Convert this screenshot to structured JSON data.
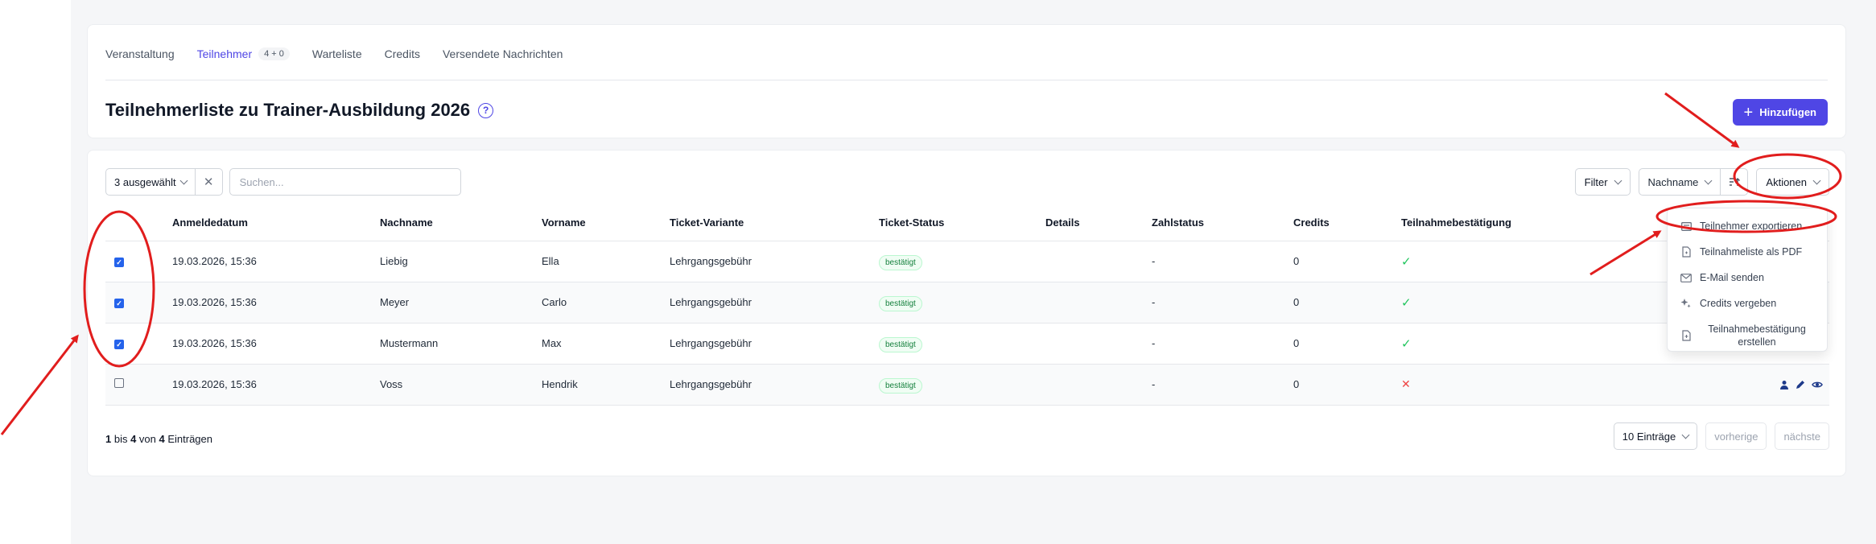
{
  "tabs": [
    {
      "label": "Veranstaltung",
      "active": false
    },
    {
      "label": "Teilnehmer",
      "active": true,
      "count": "4 + 0"
    },
    {
      "label": "Warteliste",
      "active": false
    },
    {
      "label": "Credits",
      "active": false
    },
    {
      "label": "Versendete Nachrichten",
      "active": false
    }
  ],
  "page_title": "Teilnehmerliste zu Trainer-Ausbildung 2026",
  "add_button": "Hinzufügen",
  "selection": {
    "label": "3 ausgewählt"
  },
  "search": {
    "placeholder": "Suchen...",
    "value": ""
  },
  "filter_label": "Filter",
  "sort_label": "Nachname",
  "actions_label": "Aktionen",
  "columns": [
    "Anmeldedatum",
    "Nachname",
    "Vorname",
    "Ticket-Variante",
    "Ticket-Status",
    "Details",
    "Zahlstatus",
    "Credits",
    "Teilnahmebestätigung"
  ],
  "rows": [
    {
      "checked": true,
      "date": "19.03.2026, 15:36",
      "last": "Liebig",
      "first": "Ella",
      "ticket": "Lehrgangsgebühr",
      "status": "bestätigt",
      "details": "",
      "pay": "-",
      "credits": "0",
      "confirm": "yes"
    },
    {
      "checked": true,
      "date": "19.03.2026, 15:36",
      "last": "Meyer",
      "first": "Carlo",
      "ticket": "Lehrgangsgebühr",
      "status": "bestätigt",
      "details": "",
      "pay": "-",
      "credits": "0",
      "confirm": "yes"
    },
    {
      "checked": true,
      "date": "19.03.2026, 15:36",
      "last": "Mustermann",
      "first": "Max",
      "ticket": "Lehrgangsgebühr",
      "status": "bestätigt",
      "details": "",
      "pay": "-",
      "credits": "0",
      "confirm": "yes"
    },
    {
      "checked": false,
      "date": "19.03.2026, 15:36",
      "last": "Voss",
      "first": "Hendrik",
      "ticket": "Lehrgangsgebühr",
      "status": "bestätigt",
      "details": "",
      "pay": "-",
      "credits": "0",
      "confirm": "no"
    }
  ],
  "footer": {
    "from": "1",
    "text_bis": " bis ",
    "to": "4",
    "text_von": " von ",
    "total": "4",
    "text_end": " Einträgen"
  },
  "page_size_label": "10 Einträge",
  "prev_label": "vorherige",
  "next_label": "nächste",
  "menu_items": [
    {
      "label": "Teilnehmer exportieren",
      "icon": "export-icon"
    },
    {
      "label": "Teilnahmeliste als PDF",
      "icon": "pdf-file-icon"
    },
    {
      "label": "E-Mail senden",
      "icon": "mail-icon"
    },
    {
      "label": "Credits vergeben",
      "icon": "sparkle-icon"
    },
    {
      "label": "Teilnahmebestätigung erstellen",
      "icon": "certificate-file-icon"
    }
  ],
  "colors": {
    "accent": "#4f46e5",
    "annotation": "#e11d1d",
    "success": "#22c55e",
    "error": "#ef4444"
  }
}
